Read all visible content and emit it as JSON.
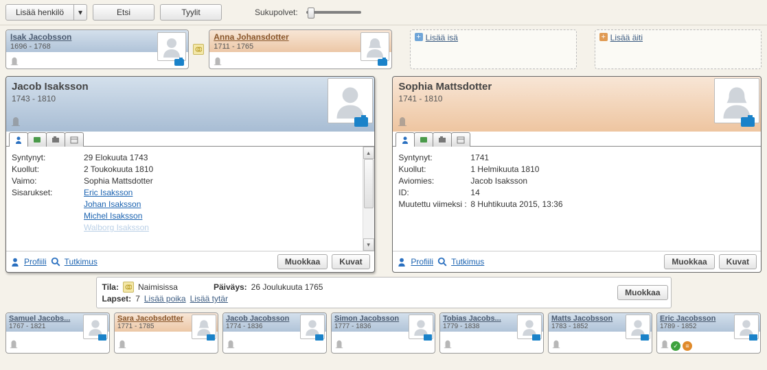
{
  "toolbar": {
    "add_person": "Lisää henkilö",
    "search": "Etsi",
    "styles": "Tyylit",
    "generations_label": "Sukupolvet:"
  },
  "placeholders": {
    "add_father": "Lisää isä",
    "add_mother": "Lisää äiti"
  },
  "parents": {
    "father": {
      "name": "Isak Jacobsson",
      "dates": "1696 - 1768"
    },
    "mother": {
      "name": "Anna Johansdotter",
      "dates": "1711 - 1765"
    }
  },
  "focus_male": {
    "name": "Jacob Isaksson",
    "dates": "1743 - 1810",
    "details": {
      "born_label": "Syntynyt:",
      "born": "29 Elokuuta 1743",
      "died_label": "Kuollut:",
      "died": "2 Toukokuuta 1810",
      "spouse_label": "Vaimo:",
      "spouse": "Sophia Mattsdotter",
      "siblings_label": "Sisarukset:",
      "siblings": [
        "Eric Isaksson",
        "Johan Isaksson",
        "Michel Isaksson",
        "Walborg Isaksson"
      ]
    }
  },
  "focus_female": {
    "name": "Sophia Mattsdotter",
    "dates": "1741 - 1810",
    "details": {
      "born_label": "Syntynyt:",
      "born": "1741",
      "died_label": "Kuollut:",
      "died": "1 Helmikuuta 1810",
      "husband_label": "Aviomies:",
      "husband": "Jacob Isaksson",
      "id_label": "ID:",
      "id": "14",
      "modified_label": "Muutettu viimeksi :",
      "modified": "8 Huhtikuuta 2015, 13:36"
    }
  },
  "panel_footer": {
    "profile": "Profiili",
    "research": "Tutkimus",
    "edit": "Muokkaa",
    "pictures": "Kuvat"
  },
  "relationship": {
    "status_label": "Tila:",
    "status": "Naimisissa",
    "date_label": "Päiväys:",
    "date": "26 Joulukuuta 1765",
    "children_label": "Lapset:",
    "children_count": "7",
    "add_son": "Lisää poika",
    "add_daughter": "Lisää tytär",
    "edit": "Muokkaa"
  },
  "children": [
    {
      "name": "Samuel Jacobs...",
      "dates": "1767 - 1821",
      "gender": "male"
    },
    {
      "name": "Sara Jacobsdotter",
      "dates": "1771 - 1785",
      "gender": "female"
    },
    {
      "name": "Jacob Jacobsson",
      "dates": "1774 - 1836",
      "gender": "male"
    },
    {
      "name": "Simon Jacobsson",
      "dates": "1777 - 1836",
      "gender": "male"
    },
    {
      "name": "Tobias Jacobs...",
      "dates": "1779 - 1838",
      "gender": "male"
    },
    {
      "name": "Matts Jacobsson",
      "dates": "1783 - 1852",
      "gender": "male"
    },
    {
      "name": "Eric Jacobsson",
      "dates": "1789 - 1852",
      "gender": "male",
      "badges": true
    }
  ]
}
